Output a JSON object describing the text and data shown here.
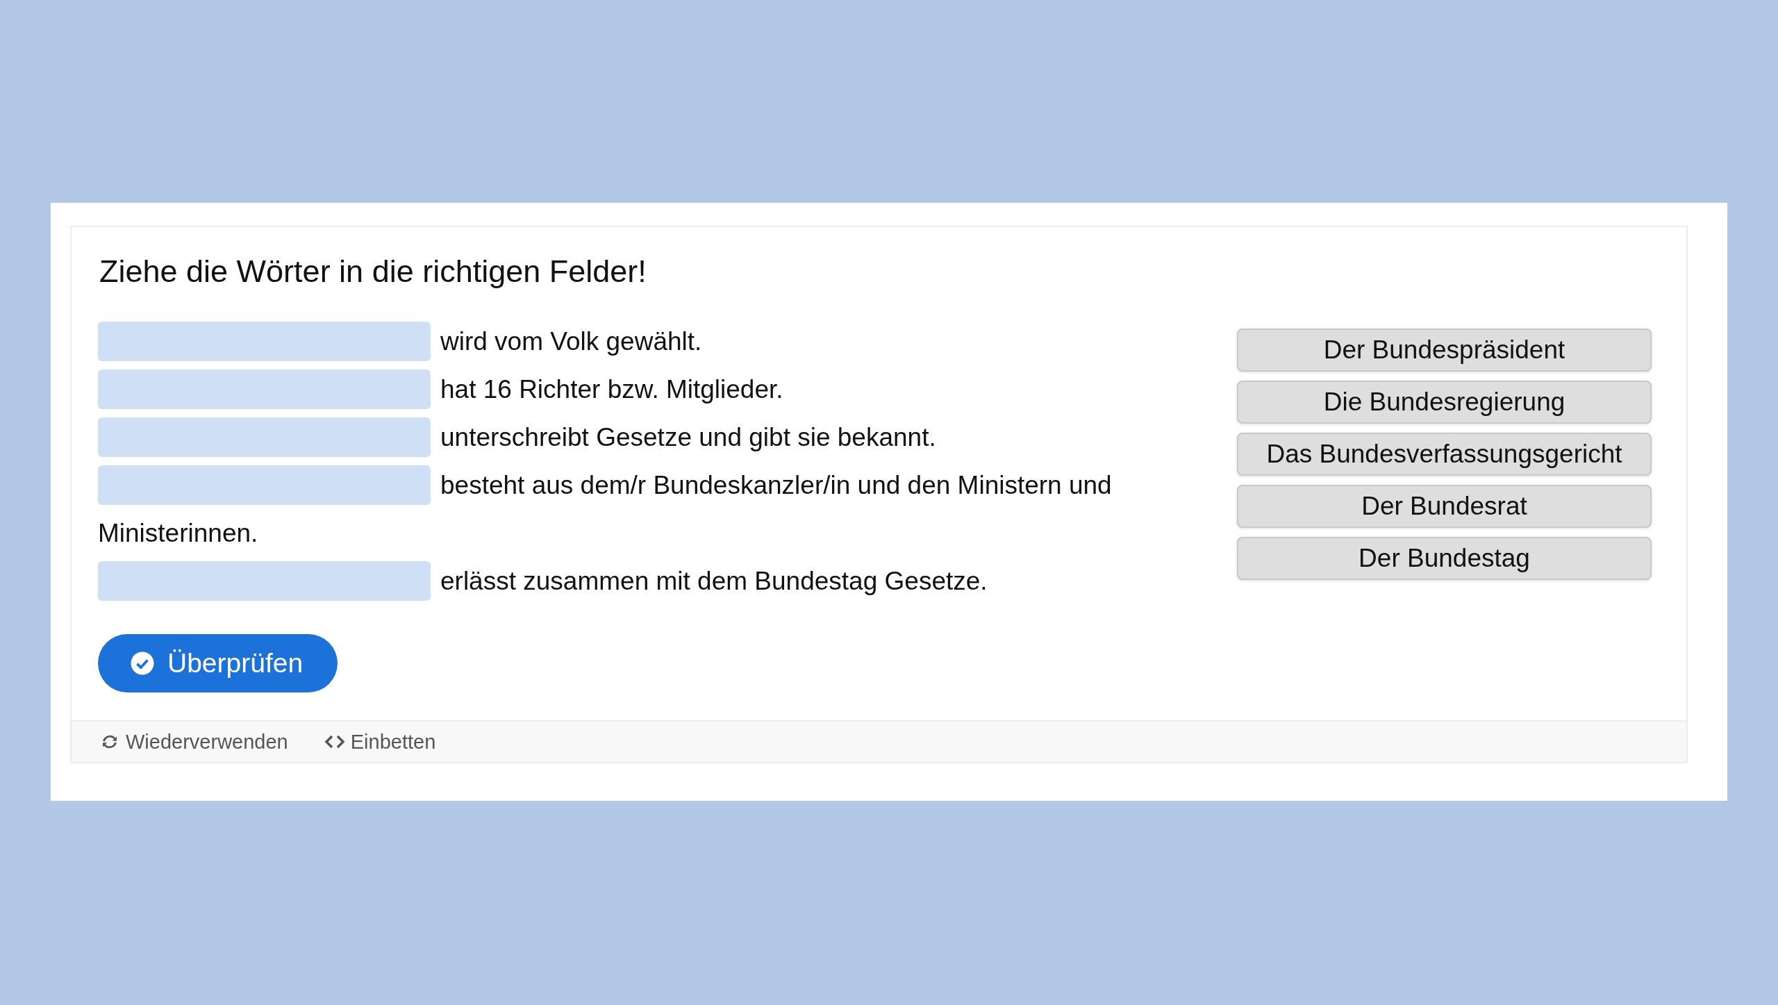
{
  "task": {
    "title": "Ziehe die Wörter in die richtigen Felder!",
    "sentences": [
      {
        "text": "wird vom Volk gewählt."
      },
      {
        "text": "hat 16 Richter bzw. Mitglieder."
      },
      {
        "text": "unterschreibt Gesetze und gibt sie bekannt."
      },
      {
        "text": "besteht aus dem/r Bundeskanzler/in und den Ministern und",
        "continued": "Ministerinnen."
      },
      {
        "text": "erlässt zusammen mit dem Bundestag Gesetze."
      }
    ],
    "words": [
      "Der Bundespräsident",
      "Die Bundesregierung",
      "Das Bundesverfassungsgericht",
      "Der Bundesrat",
      "Der Bundestag"
    ],
    "check_button": "Überprüfen"
  },
  "footer": {
    "links": [
      "Wiederverwenden",
      "Einbetten"
    ]
  }
}
